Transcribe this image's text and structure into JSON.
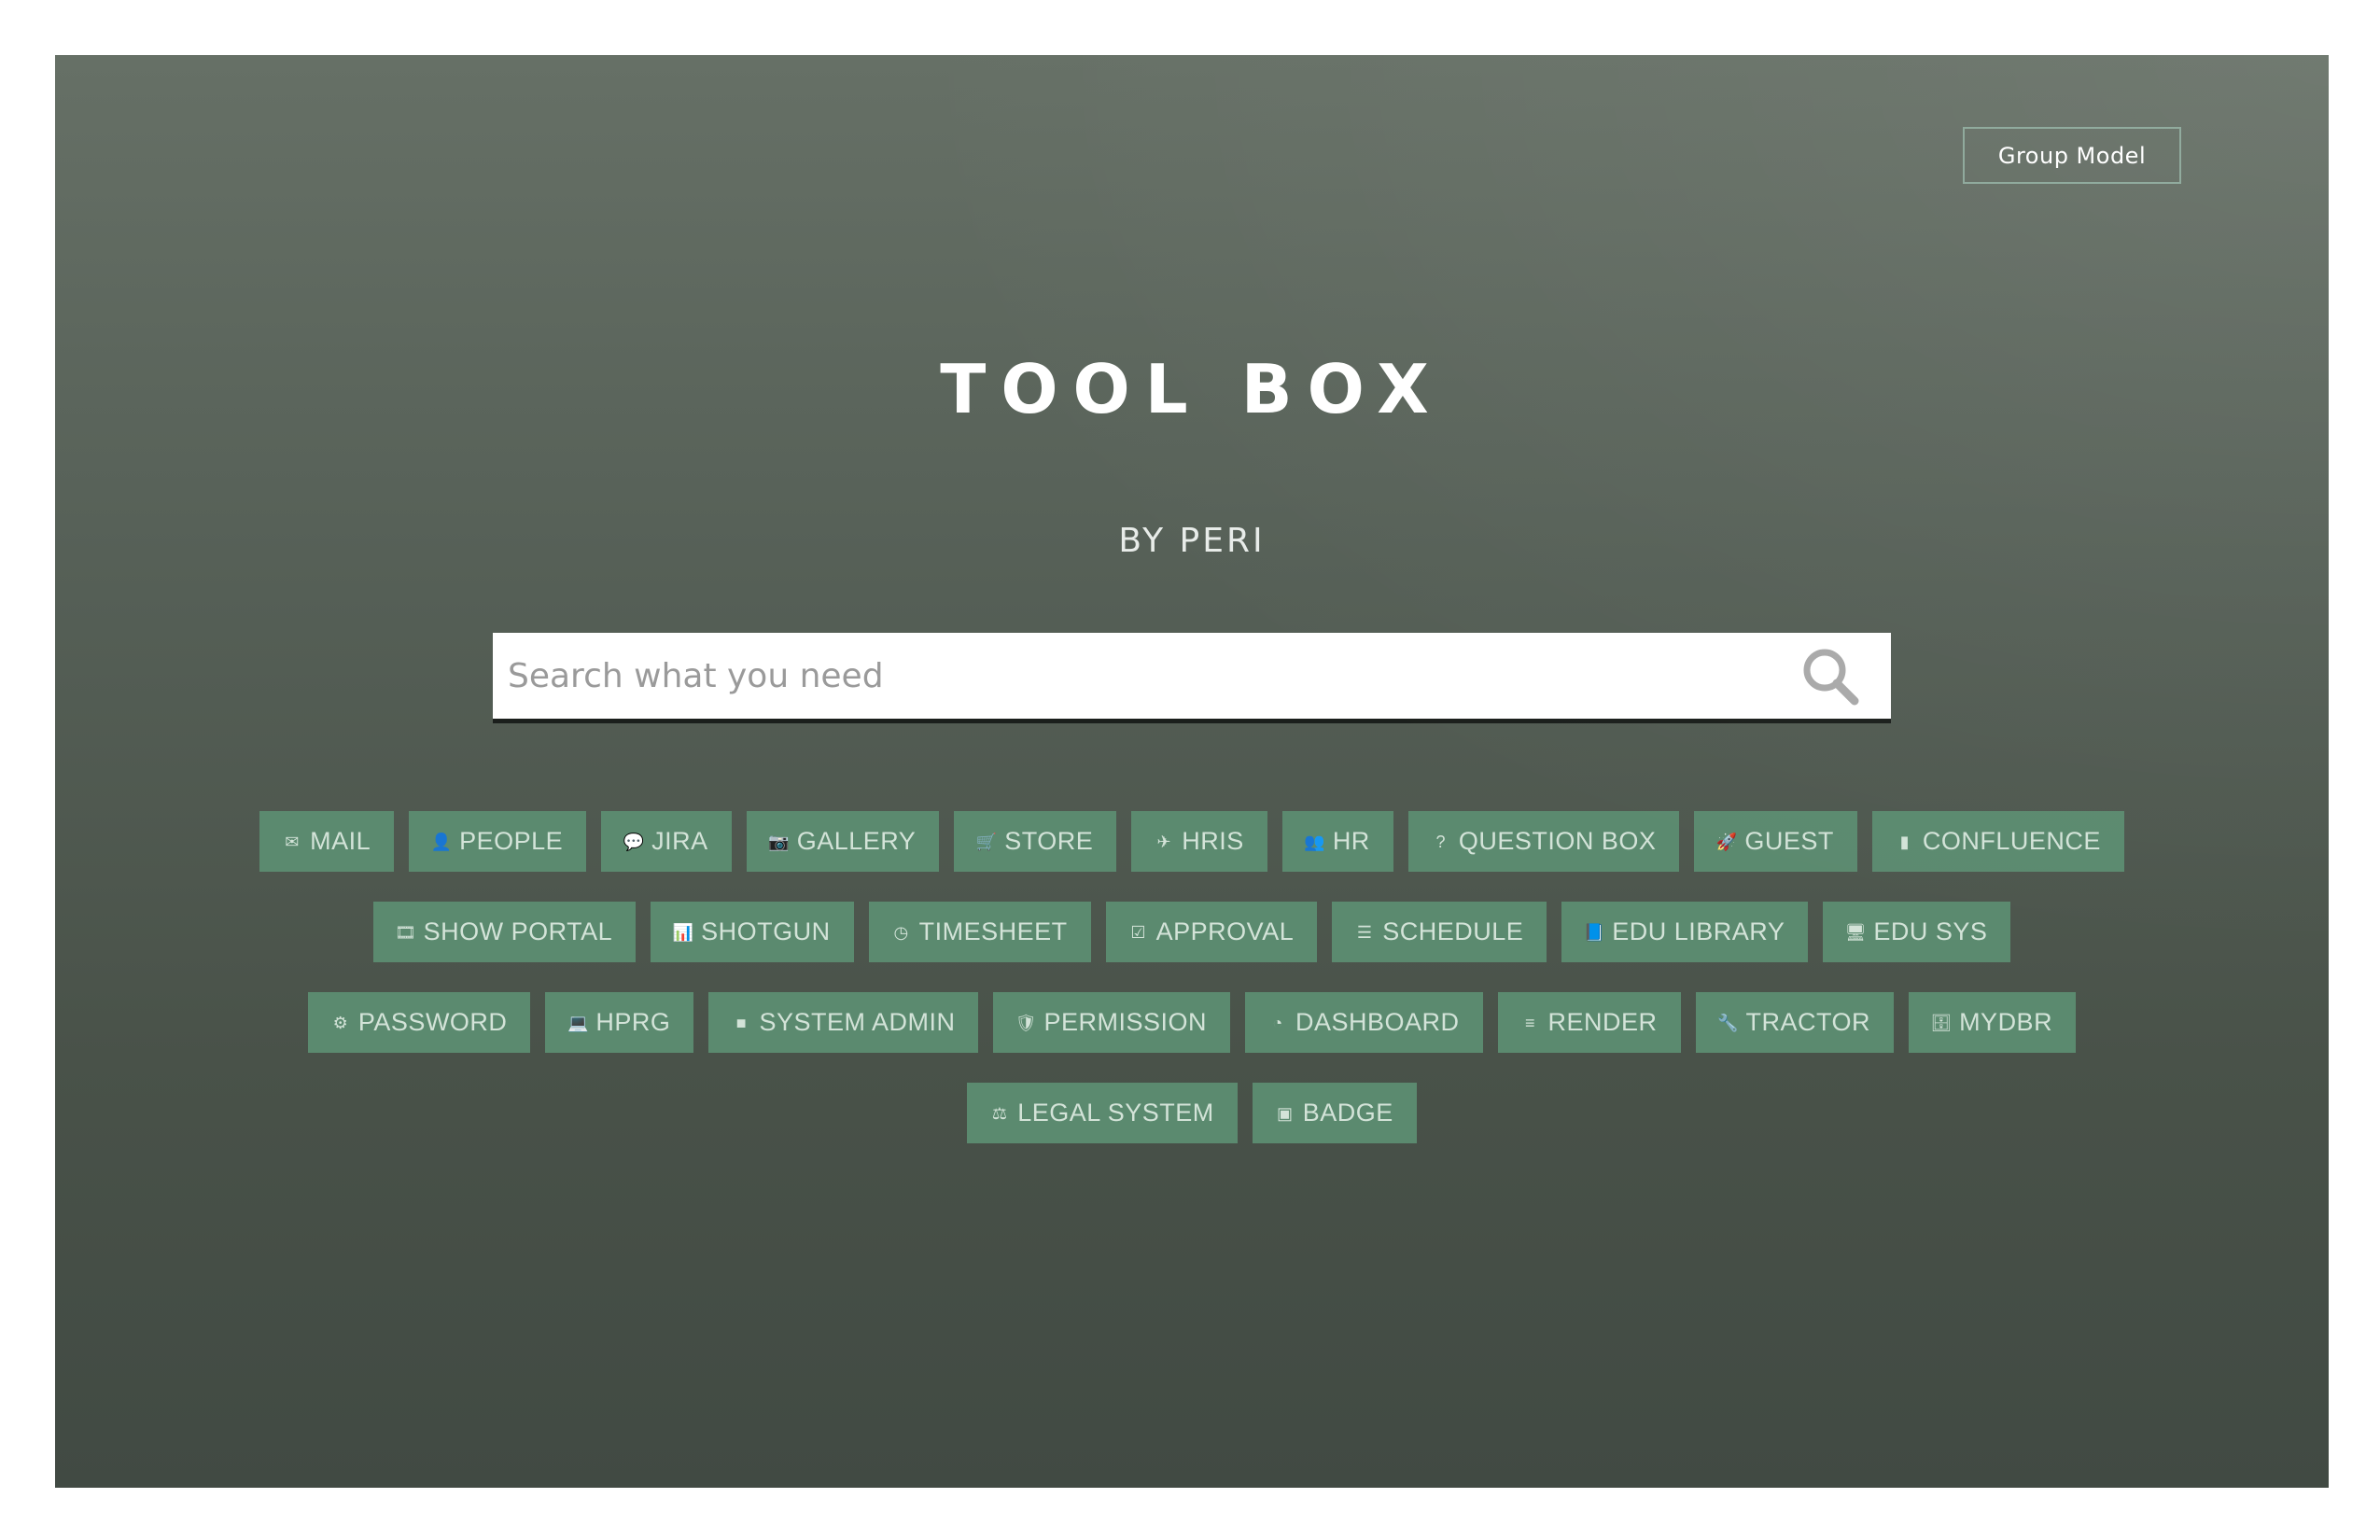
{
  "header": {
    "group_button_label": "Group Model"
  },
  "hero": {
    "title": "TOOL BOX",
    "subtitle": "BY PERI"
  },
  "search": {
    "placeholder": "Search what you need",
    "value": "",
    "icon": "search-icon"
  },
  "colors": {
    "tag_background": "#5b8a6f",
    "tag_text": "#d3e3d8",
    "background_top": "#667066",
    "background_bottom": "#414a43",
    "search_border": "#1b1f1c"
  },
  "tag_rows": [
    [
      {
        "label": "MAIL",
        "icon": "envelope-icon",
        "glyph": "✉"
      },
      {
        "label": "PEOPLE",
        "icon": "user-icon",
        "glyph": "👤"
      },
      {
        "label": "JIRA",
        "icon": "comments-icon",
        "glyph": "💬"
      },
      {
        "label": "GALLERY",
        "icon": "camera-icon",
        "glyph": "📷"
      },
      {
        "label": "STORE",
        "icon": "cart-icon",
        "glyph": "🛒"
      },
      {
        "label": "HRIS",
        "icon": "plane-icon",
        "glyph": "✈"
      },
      {
        "label": "HR",
        "icon": "users-icon",
        "glyph": "👥"
      },
      {
        "label": "QUESTION BOX",
        "icon": "question-icon",
        "glyph": "?"
      },
      {
        "label": "GUEST",
        "icon": "rocket-icon",
        "glyph": "🚀"
      },
      {
        "label": "CONFLUENCE",
        "icon": "book-icon",
        "glyph": "▮"
      }
    ],
    [
      {
        "label": "SHOW PORTAL",
        "icon": "film-icon",
        "glyph": "🎞"
      },
      {
        "label": "SHOTGUN",
        "icon": "bar-chart-icon",
        "glyph": "📊"
      },
      {
        "label": "TIMESHEET",
        "icon": "clock-icon",
        "glyph": "◷"
      },
      {
        "label": "APPROVAL",
        "icon": "check-square-icon",
        "glyph": "☑"
      },
      {
        "label": "SCHEDULE",
        "icon": "list-icon",
        "glyph": "☰"
      },
      {
        "label": "EDU LIBRARY",
        "icon": "book-icon",
        "glyph": "📘"
      },
      {
        "label": "EDU SYS",
        "icon": "desktop-icon",
        "glyph": "🖥"
      }
    ],
    [
      {
        "label": "PASSWORD",
        "icon": "gears-icon",
        "glyph": "⚙"
      },
      {
        "label": "HPRG",
        "icon": "laptop-icon",
        "glyph": "💻"
      },
      {
        "label": "SYSTEM ADMIN",
        "icon": "server-icon",
        "glyph": "■"
      },
      {
        "label": "PERMISSION",
        "icon": "shield-icon",
        "glyph": "🛡"
      },
      {
        "label": "DASHBOARD",
        "icon": "dashboard-icon",
        "glyph": "◔"
      },
      {
        "label": "RENDER",
        "icon": "sliders-icon",
        "glyph": "≡"
      },
      {
        "label": "TRACTOR",
        "icon": "wrench-icon",
        "glyph": "🔧"
      },
      {
        "label": "MYDBR",
        "icon": "database-icon",
        "glyph": "🗄"
      }
    ],
    [
      {
        "label": "LEGAL SYSTEM",
        "icon": "gavel-icon",
        "glyph": "⚖"
      },
      {
        "label": "BADGE",
        "icon": "badge-icon",
        "glyph": "▣"
      }
    ]
  ]
}
